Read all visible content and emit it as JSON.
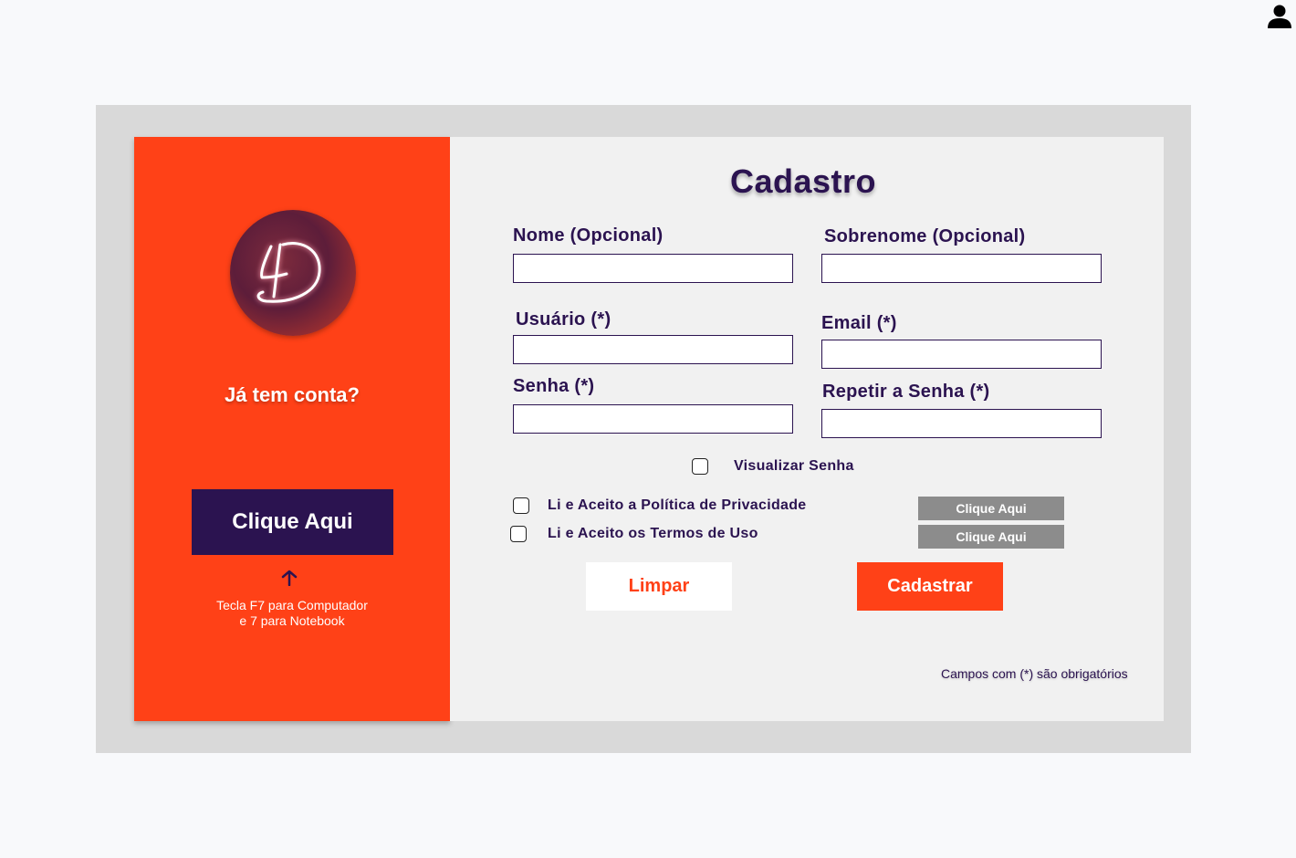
{
  "header": {
    "user_icon": "user-icon"
  },
  "login_panel": {
    "logo_icon": "4d-neon-logo",
    "question": "Já tem conta?",
    "button_label": "Clique Aqui",
    "arrow_icon": "arrow-up-icon",
    "hint_line1": "Tecla F7 para Computador",
    "hint_line2": "e 7 para Notebook",
    "background_color": "#ff4117",
    "button_color": "#2b1350"
  },
  "form": {
    "title": "Cadastro",
    "fields": {
      "first_name": {
        "label": "Nome (Opcional)",
        "value": ""
      },
      "last_name": {
        "label": "Sobrenome (Opcional)",
        "value": ""
      },
      "username": {
        "label": "Usuário (*)",
        "value": ""
      },
      "email": {
        "label": "Email (*)",
        "value": ""
      },
      "password": {
        "label": "Senha (*)",
        "value": ""
      },
      "repeat_password": {
        "label": "Repetir a Senha (*)",
        "value": ""
      }
    },
    "show_password": {
      "label": "Visualizar Senha",
      "checked": false
    },
    "privacy_policy": {
      "label": "Li e Aceito a Política de Privacidade",
      "checked": false,
      "link_label": "Clique Aqui"
    },
    "terms_of_use": {
      "label": "Li e Aceito os Termos de Uso",
      "checked": false,
      "link_label": "Clique Aqui"
    },
    "clear_button": "Limpar",
    "submit_button": "Cadastrar",
    "required_note": "Campos com (*) são obrigatórios",
    "accent_color": "#ff4117",
    "text_color": "#2b1350"
  }
}
